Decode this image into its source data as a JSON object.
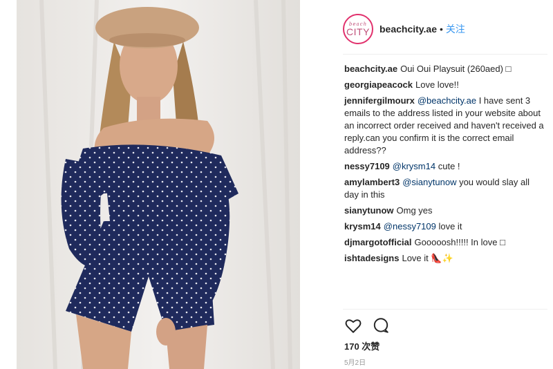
{
  "post": {
    "account": "beachcity.ae",
    "follow_label": "关注",
    "separator_dot": "•",
    "avatar_small": "beach",
    "avatar_big": "CITY"
  },
  "comments": [
    {
      "user": "beachcity.ae",
      "mention": "",
      "text": "Oui Oui Playsuit (260aed) □"
    },
    {
      "user": "georgiapeacock",
      "mention": "",
      "text": "Love love!!"
    },
    {
      "user": "jennifergilmourx",
      "mention": "@beachcity.ae",
      "text": " I have sent 3 emails to the address listed in your website about an incorrect order received and haven't received a reply.can you confirm it is the correct email address??"
    },
    {
      "user": "nessy7109",
      "mention": "@krysm14",
      "text": " cute !"
    },
    {
      "user": "amylambert3",
      "mention": "@sianytunow",
      "text": " you would slay all day in this"
    },
    {
      "user": "sianytunow",
      "mention": "",
      "text": "Omg yes"
    },
    {
      "user": "krysm14",
      "mention": "@nessy7109",
      "text": " love it"
    },
    {
      "user": "djmargotofficial",
      "mention": "",
      "text": "Gooooosh!!!!! In love □"
    },
    {
      "user": "ishtadesigns",
      "mention": "",
      "text": "Love it 👠✨"
    }
  ],
  "footer": {
    "likes": "170 次赞",
    "date": "5月2日"
  },
  "colors": {
    "accent": "#3897f0",
    "dress": "#1f2a5c",
    "hat": "#c9a27f"
  },
  "icons": [
    "heart-icon",
    "comment-icon"
  ]
}
